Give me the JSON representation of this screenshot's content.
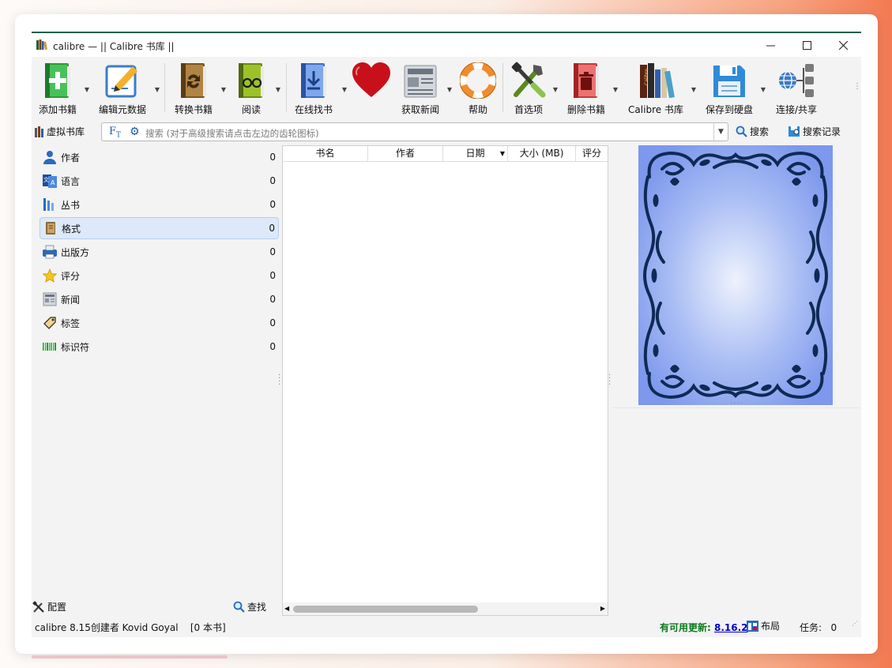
{
  "window": {
    "title": "calibre — || Calibre 书库 ||",
    "controls": [
      "minimize",
      "maximize",
      "close"
    ]
  },
  "toolbar": {
    "items": [
      {
        "label": "添加书籍",
        "icon": "add-book-icon",
        "dropdown": true
      },
      {
        "label": "编辑元数据",
        "icon": "edit-metadata-icon",
        "dropdown": true
      },
      {
        "label": "转换书籍",
        "icon": "convert-book-icon",
        "dropdown": true
      },
      {
        "label": "阅读",
        "icon": "read-book-icon",
        "dropdown": true
      },
      {
        "label": "在线找书",
        "icon": "store-icon",
        "dropdown": true
      },
      {
        "label": "",
        "icon": "donate-heart-icon",
        "dropdown": false
      },
      {
        "label": "获取新闻",
        "icon": "fetch-news-icon",
        "dropdown": true
      },
      {
        "label": "帮助",
        "icon": "help-lifebuoy-icon",
        "dropdown": false
      },
      {
        "label": "首选项",
        "icon": "preferences-icon",
        "dropdown": true
      },
      {
        "label": "删除书籍",
        "icon": "remove-book-icon",
        "dropdown": true
      },
      {
        "label": "Calibre 书库",
        "icon": "library-icon",
        "dropdown": true
      },
      {
        "label": "保存到硬盘",
        "icon": "save-disk-icon",
        "dropdown": true
      },
      {
        "label": "连接/共享",
        "icon": "connect-share-icon",
        "dropdown": false
      }
    ]
  },
  "search": {
    "virtual_library": "虚拟书库",
    "placeholder": "搜索 (对于高级搜索请点击左边的齿轮图标)",
    "search_button": "搜索",
    "saved_searches_button": "搜索记录"
  },
  "tag_browser": {
    "items": [
      {
        "label": "作者",
        "count": "0",
        "icon": "person-icon"
      },
      {
        "label": "语言",
        "count": "0",
        "icon": "language-icon"
      },
      {
        "label": "丛书",
        "count": "0",
        "icon": "series-icon"
      },
      {
        "label": "格式",
        "count": "0",
        "icon": "format-icon",
        "selected": true
      },
      {
        "label": "出版方",
        "count": "0",
        "icon": "publisher-icon"
      },
      {
        "label": "评分",
        "count": "0",
        "icon": "star-icon"
      },
      {
        "label": "新闻",
        "count": "0",
        "icon": "news-icon"
      },
      {
        "label": "标签",
        "count": "0",
        "icon": "tag-icon"
      },
      {
        "label": "标识符",
        "count": "0",
        "icon": "barcode-icon"
      }
    ],
    "configure_button": "配置",
    "find_button": "查找"
  },
  "book_list": {
    "columns": [
      "书名",
      "作者",
      "日期",
      "大小 (MB)",
      "评分"
    ],
    "sorted_column": "日期",
    "rows": []
  },
  "status_bar": {
    "version_text": "calibre 8.15创建者 Kovid Goyal",
    "book_count": "[0 本书]",
    "update_label": "有可用更新:",
    "update_version": "8.16.2",
    "layout_button": "布局",
    "jobs_text": "任务:   0"
  },
  "colors": {
    "accent_line": "#1c5f4e",
    "selected_row": "#dde9f9",
    "update_green": "#0a7a1a",
    "link_blue": "#0000cc",
    "cover_blue": "#7d98ec"
  }
}
